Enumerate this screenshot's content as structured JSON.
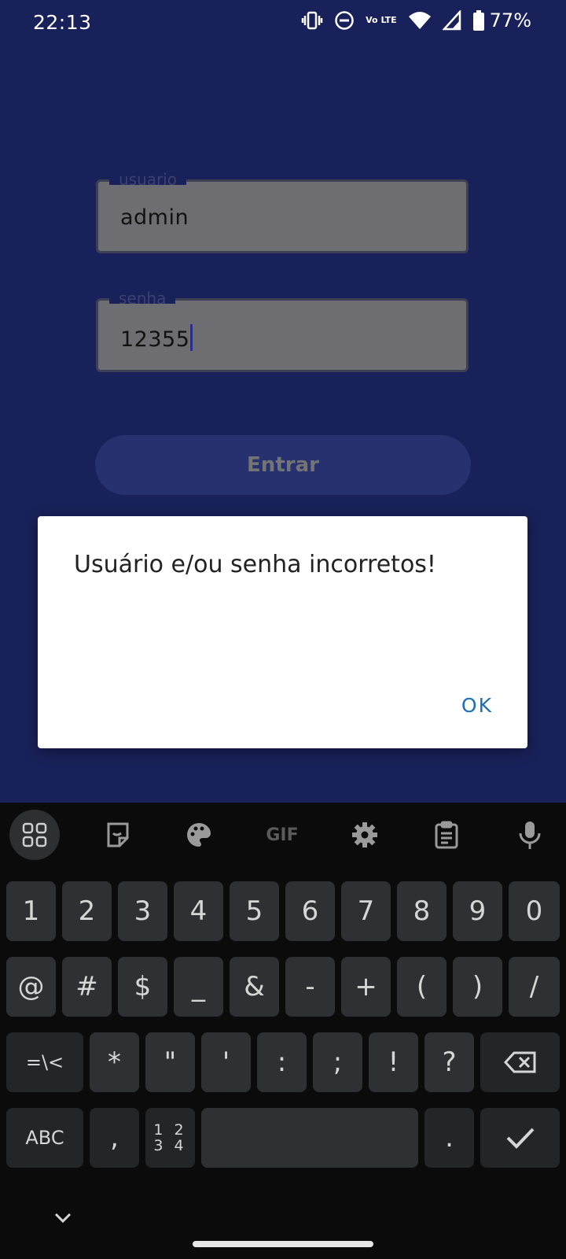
{
  "status_bar": {
    "time": "22:13",
    "network": "Vo LTE",
    "battery": "77%"
  },
  "login": {
    "username_label": "usuario",
    "username_value": "admin",
    "password_label": "senha",
    "password_value": "12355",
    "submit_label": "Entrar"
  },
  "dialog": {
    "message": "Usuário e/ou senha incorretos!",
    "ok_label": "OK"
  },
  "keyboard": {
    "toolbar": {
      "gif_label": "GIF"
    },
    "row1": [
      "1",
      "2",
      "3",
      "4",
      "5",
      "6",
      "7",
      "8",
      "9",
      "0"
    ],
    "row2": [
      "@",
      "#",
      "$",
      "_",
      "&",
      "-",
      "+",
      "(",
      ")",
      "/"
    ],
    "row3": {
      "mode": "=\\<",
      "keys": [
        "*",
        "\"",
        "'",
        ":",
        ";",
        "!",
        "?"
      ]
    },
    "row4": {
      "abc": "ABC",
      "comma": ",",
      "nums_top": "1 2",
      "nums_bottom": "3 4",
      "period": "."
    }
  }
}
